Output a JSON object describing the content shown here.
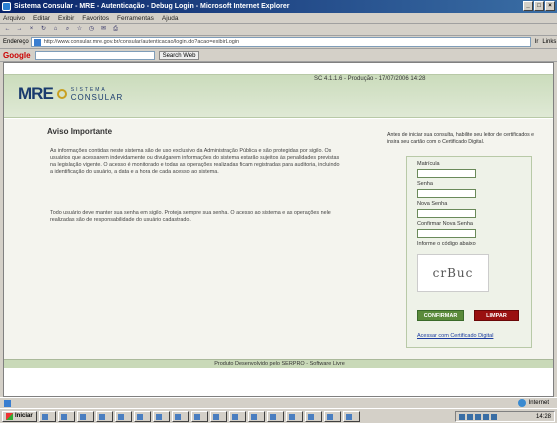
{
  "window": {
    "title": "Sistema Consular - MRE - Autenticação - Debug Login - Microsoft Internet Explorer"
  },
  "menu": [
    "Arquivo",
    "Editar",
    "Exibir",
    "Favoritos",
    "Ferramentas",
    "Ajuda"
  ],
  "address": {
    "label": "Endereço",
    "url": "http://www.consular.mre.gov.br/consular/autenticacao/login.do?acao=exibirLogin",
    "go_label": "Ir",
    "links_label": "Links"
  },
  "google_bar": {
    "logo": "Google",
    "search_web_label": "Search Web"
  },
  "page": {
    "version_text": "SC 4.1.1.6 - Produção - 17/07/2006 14:28",
    "logo_mre": "MRE",
    "logo_line1": "SISTEMA",
    "logo_line2": "CONSULAR",
    "aviso_title": "Aviso Importante",
    "aviso_paragraph1": "As informações contidas neste sistema são de uso exclusivo da Administração Pública e são protegidas por sigilo. Os usuários que acessarem indevidamente ou divulgarem informações do sistema estarão sujeitos às penalidades previstas na legislação vigente. O acesso é monitorado e todas as operações realizadas ficam registradas para auditoria, incluindo a identificação do usuário, a data e a hora de cada acesso ao sistema.",
    "aviso_paragraph2": "Todo usuário deve manter sua senha em sigilo. Proteja sempre sua senha. O acesso ao sistema e as operações nele realizadas são de responsabilidade do usuário cadastrado.",
    "login_intro": "Antes de iniciar sua consulta, habilite seu leitor de certificados e insira seu cartão com o Certificado Digital.",
    "fields": {
      "matricula_label": "Matrícula",
      "senha_label": "Senha",
      "nova_senha_label": "Nova Senha",
      "confirmar_senha_label": "Confirmar Nova Senha",
      "captcha_label": "Informe o código abaixo"
    },
    "captcha_text": "crBuc",
    "confirmar_button": "CONFIRMAR",
    "limpar_button": "LIMPAR",
    "cert_link": "Acessar com Certificado Digital",
    "footer": "Produto Desenvolvido pelo SERPRO - Software Livre"
  },
  "status": {
    "zone": "Internet"
  },
  "taskbar": {
    "start_label": "Iniciar",
    "clock": "14:28"
  },
  "colors": {
    "header_band": "#cbdcbc",
    "confirmar": "#5a8a3a",
    "limpar": "#9a1010",
    "brand": "#1a3b6e"
  }
}
